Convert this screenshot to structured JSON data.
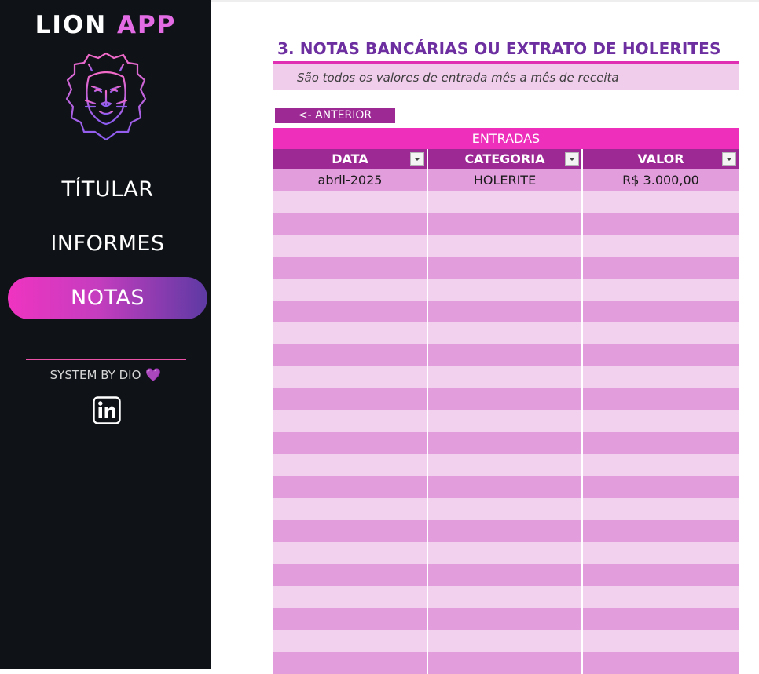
{
  "sidebar": {
    "brand_part1": "LION",
    "brand_part2": "APP",
    "nav": [
      {
        "label": "TÍTULAR",
        "active": false
      },
      {
        "label": "INFORMES",
        "active": false
      },
      {
        "label": "NOTAS",
        "active": true
      }
    ],
    "footer_text": "SYSTEM BY DIO",
    "heart_icon": "purple-heart-icon",
    "linkedin_icon": "linkedin-icon",
    "lion_logo": "lion-head-icon"
  },
  "main": {
    "title": "3. NOTAS BANCÁRIAS OU EXTRATO DE HOLERITES",
    "subtitle": "São todos os valores de entrada mês a mês de receita",
    "prev_button": "<- ANTERIOR",
    "table": {
      "caption": "ENTRADAS",
      "columns": [
        "DATA",
        "CATEGORIA",
        "VALOR"
      ],
      "rows": [
        [
          "abril-2025",
          "HOLERITE",
          "R$ 3.000,00"
        ]
      ],
      "empty_rows": 22
    }
  },
  "colors": {
    "sidebar_bg": "#0f1317",
    "accent_pink": "#ee2fbb",
    "accent_purple": "#9d2a94",
    "title_purple": "#6d2fa0",
    "row_dark": "#e29ddc",
    "row_light": "#f1d1ee"
  }
}
